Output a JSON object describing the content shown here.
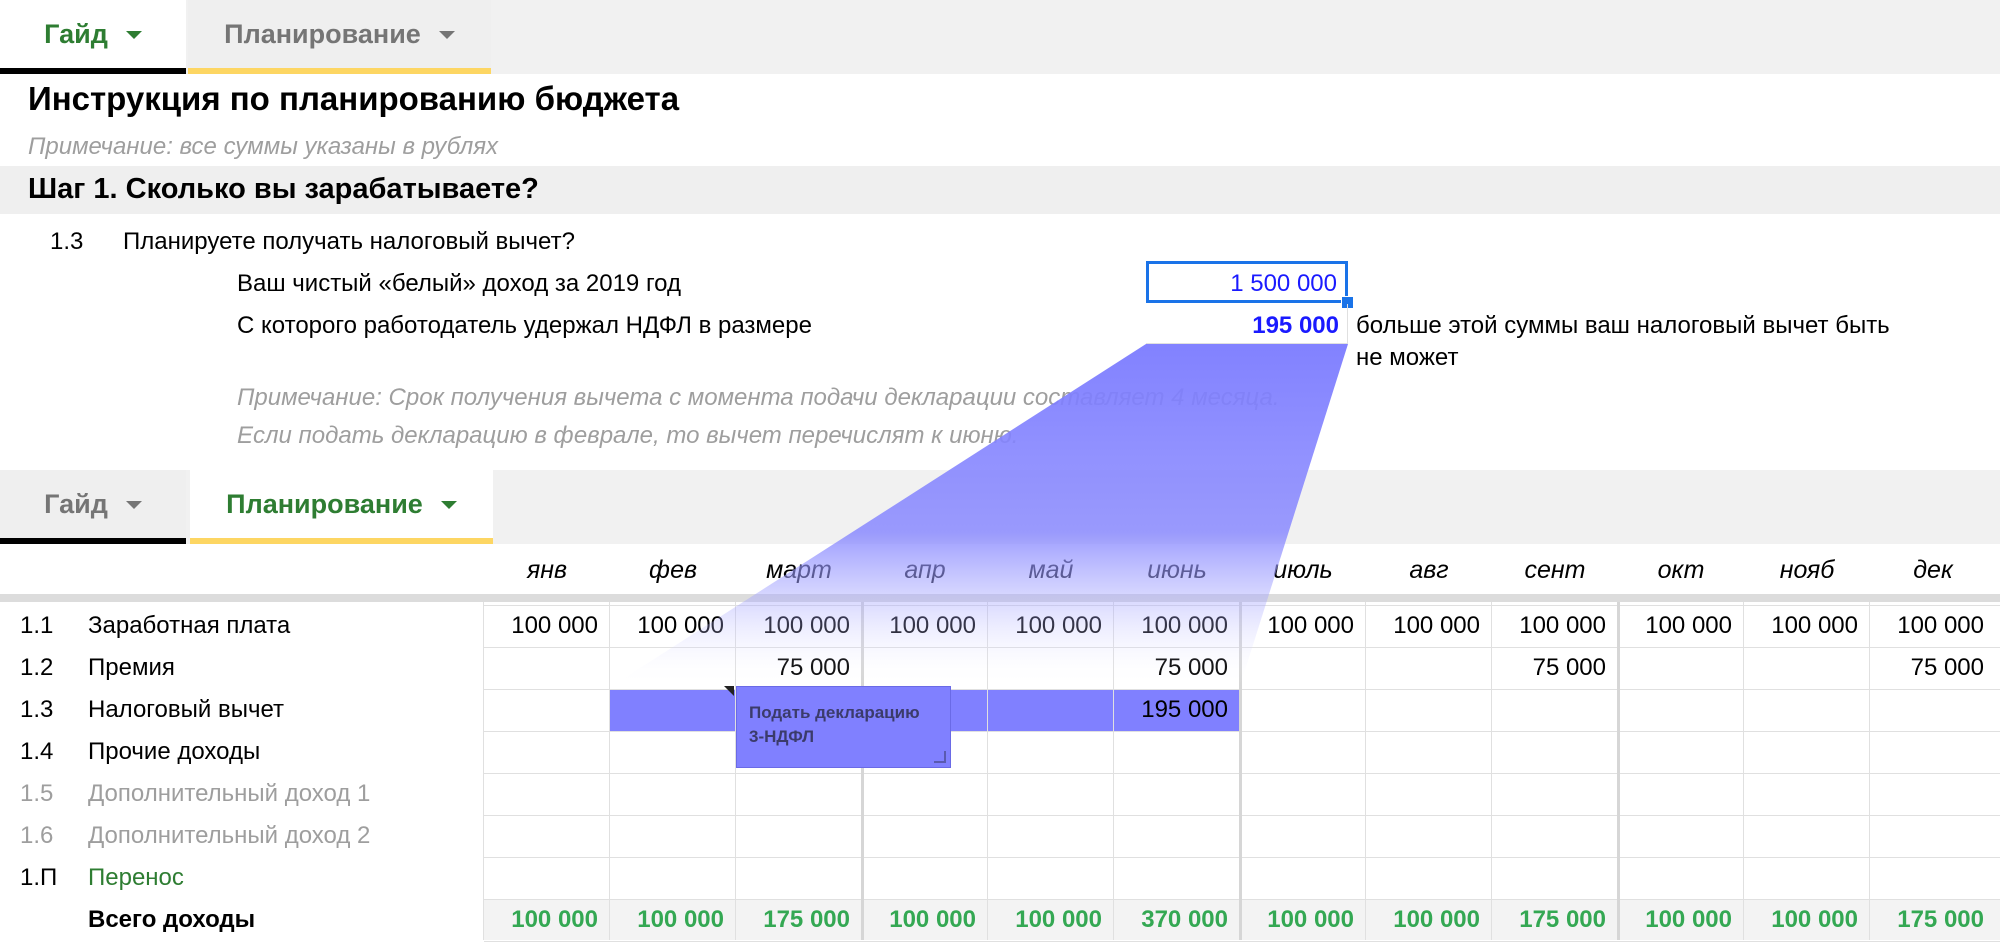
{
  "top_tabs": [
    {
      "label": "Гайд",
      "active": true
    },
    {
      "label": "Планирование",
      "active": false
    }
  ],
  "guide": {
    "title": "Инструкция по планированию бюджета",
    "note": "Примечание: все суммы указаны в рублях",
    "step": "Шаг 1. Сколько вы зарабатываете?",
    "question_num": "1.3",
    "question": "Планируете получать налоговый вычет?",
    "income_label": "Ваш чистый «белый» доход за 2019 год",
    "income_value": "1 500 000",
    "ndfl_label": "С которого работодатель удержал НДФЛ в размере",
    "ndfl_value": "195 000",
    "ndfl_hint_line1": "больше этой суммы ваш налоговый вычет быть",
    "ndfl_hint_line2": "не может",
    "note2_line1": "Примечание: Срок получения вычета с момента подачи декларации составляет 4 месяца.",
    "note2_line2": "Если подать декларацию в феврале, то вычет перечислят к июню."
  },
  "bottom_tabs": [
    {
      "label": "Гайд",
      "active": false
    },
    {
      "label": "Планирование",
      "active": true
    }
  ],
  "months": [
    "янв",
    "фев",
    "март",
    "апр",
    "май",
    "июнь",
    "июль",
    "авг",
    "сент",
    "окт",
    "нояб",
    "дек"
  ],
  "rows": [
    {
      "num": "1.1",
      "label": "Заработная плата",
      "style": "normal",
      "values": [
        "100 000",
        "100 000",
        "100 000",
        "100 000",
        "100 000",
        "100 000",
        "100 000",
        "100 000",
        "100 000",
        "100 000",
        "100 000",
        "100 000"
      ]
    },
    {
      "num": "1.2",
      "label": "Премия",
      "style": "normal",
      "values": [
        "",
        "",
        "75 000",
        "",
        "",
        "75 000",
        "",
        "",
        "75 000",
        "",
        "",
        "75 000"
      ]
    },
    {
      "num": "1.3",
      "label": "Налоговый вычет",
      "style": "normal",
      "values": [
        "",
        "",
        "",
        "",
        "",
        "195 000",
        "",
        "",
        "",
        "",
        "",
        ""
      ]
    },
    {
      "num": "1.4",
      "label": "Прочие доходы",
      "style": "normal",
      "values": [
        "",
        "",
        "",
        "",
        "",
        "",
        "",
        "",
        "",
        "",
        "",
        ""
      ]
    },
    {
      "num": "1.5",
      "label": "Дополнительный доход 1",
      "style": "muted",
      "values": [
        "",
        "",
        "",
        "",
        "",
        "",
        "",
        "",
        "",
        "",
        "",
        ""
      ]
    },
    {
      "num": "1.6",
      "label": "Дополнительный доход 2",
      "style": "muted",
      "values": [
        "",
        "",
        "",
        "",
        "",
        "",
        "",
        "",
        "",
        "",
        "",
        ""
      ]
    },
    {
      "num": "1.П",
      "label": "Перенос",
      "style": "green",
      "values": [
        "",
        "",
        "",
        "",
        "",
        "",
        "",
        "",
        "",
        "",
        "",
        ""
      ]
    },
    {
      "num": "",
      "label": "Всего доходы",
      "style": "total",
      "values": [
        "100 000",
        "100 000",
        "175 000",
        "100 000",
        "100 000",
        "370 000",
        "100 000",
        "100 000",
        "175 000",
        "100 000",
        "100 000",
        "175 000"
      ]
    }
  ],
  "comment": {
    "line1": "Подать декларацию",
    "line2": "3-НДФЛ"
  },
  "colors": {
    "accent_green": "#2e7d32",
    "total_green": "#34a853",
    "highlight": "#8080ff",
    "input_blue": "#1a73e8",
    "value_blue": "#1a1aff"
  }
}
